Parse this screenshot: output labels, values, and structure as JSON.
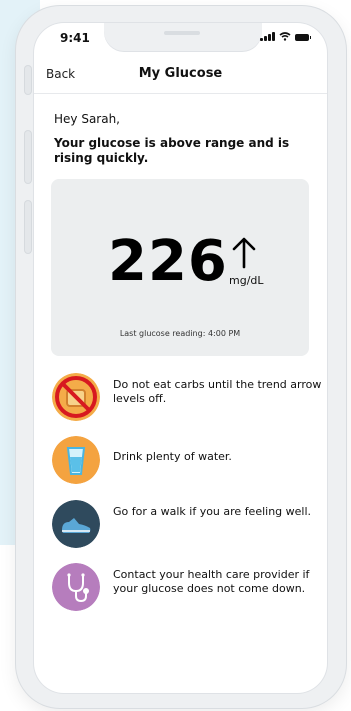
{
  "status_bar": {
    "time": "9:41"
  },
  "nav": {
    "back_label": "Back",
    "title": "My Glucose"
  },
  "greeting": "Hey Sarah,",
  "headline": "Your glucose is above range and is rising quickly.",
  "reading": {
    "value": "226",
    "unit": "mg/dL",
    "trend": "rising",
    "last_reading": "Last glucose reading: 4:00 PM"
  },
  "tips": [
    {
      "icon": "no-carbs-icon",
      "text": "Do not eat carbs until the trend arrow levels off.",
      "color": "#f1a53a"
    },
    {
      "icon": "water-glass-icon",
      "text": "Drink plenty of water.",
      "color": "#f4a340"
    },
    {
      "icon": "shoe-icon",
      "text": "Go for a walk if you are feeling well.",
      "color": "#2f4a5d"
    },
    {
      "icon": "stethoscope-icon",
      "text": "Contact your health care provider if your glucose does not come down.",
      "color": "#b67dbd"
    }
  ]
}
